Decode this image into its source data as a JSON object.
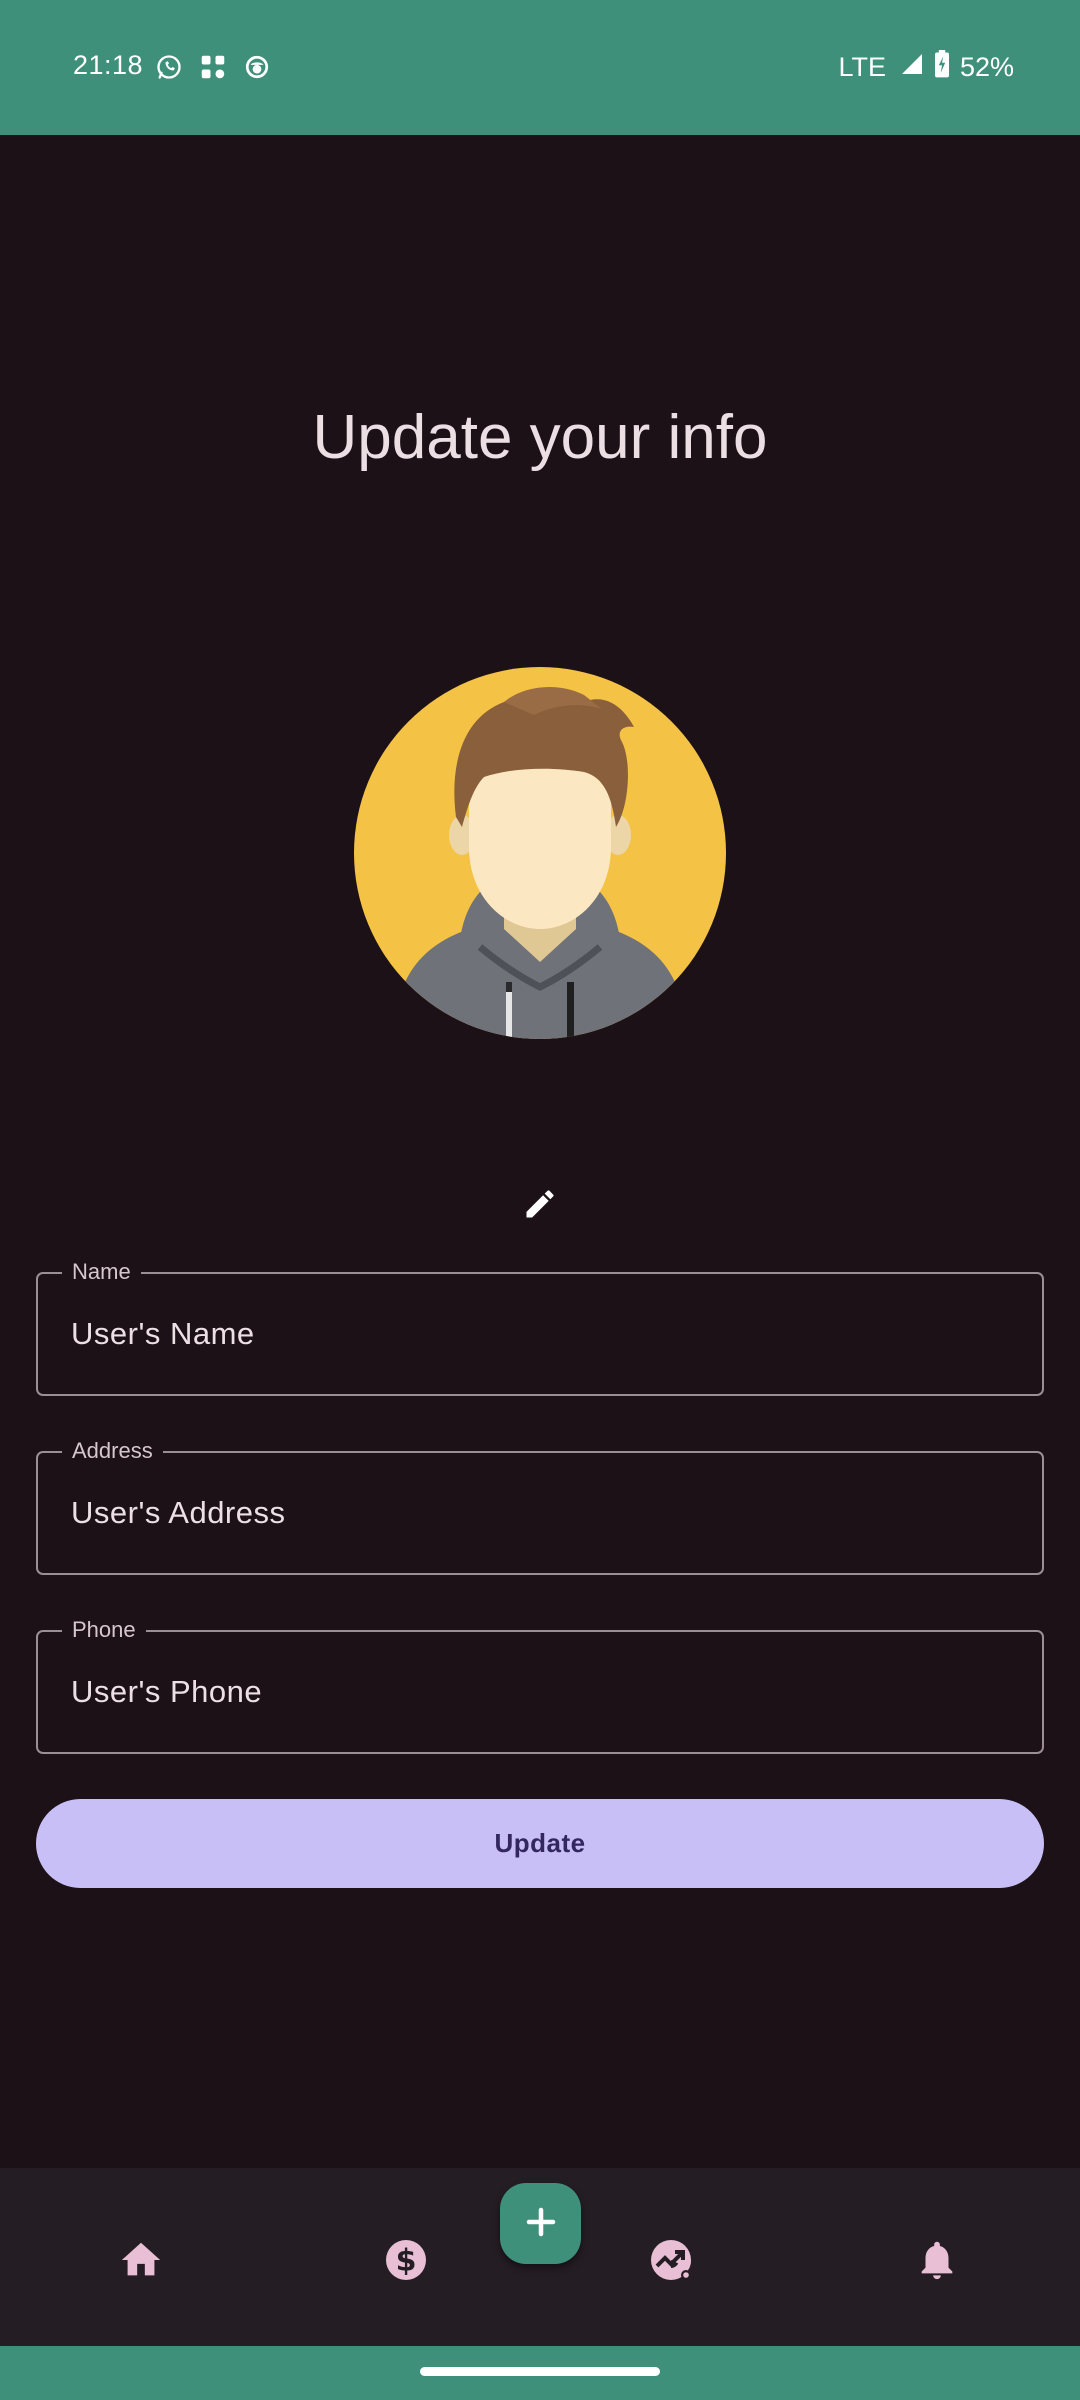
{
  "status_bar": {
    "time": "21:18",
    "notification_icons": [
      "whatsapp-icon",
      "music-icon",
      "app-face-icon"
    ],
    "network": "LTE",
    "battery": "52%",
    "battery_level": 0.52
  },
  "page": {
    "title": "Update your info"
  },
  "avatar": {
    "icon": "user-avatar",
    "background_color": "#f4c244"
  },
  "form": {
    "fields": [
      {
        "label": "Name",
        "value": "User's Name"
      },
      {
        "label": "Address",
        "value": "User's Address"
      },
      {
        "label": "Phone",
        "value": "User's Phone"
      }
    ],
    "submit_label": "Update"
  },
  "bottom_nav": {
    "items": [
      {
        "icon": "home-icon"
      },
      {
        "icon": "dollar-icon"
      },
      {
        "icon": "trending-icon"
      },
      {
        "icon": "bell-icon"
      }
    ],
    "fab_icon": "plus-icon"
  },
  "colors": {
    "accent": "#3f907a",
    "background": "#1b1116",
    "button": "#c8bff7",
    "nav_background": "#251d24",
    "nav_icon": "#e8bfd4"
  }
}
